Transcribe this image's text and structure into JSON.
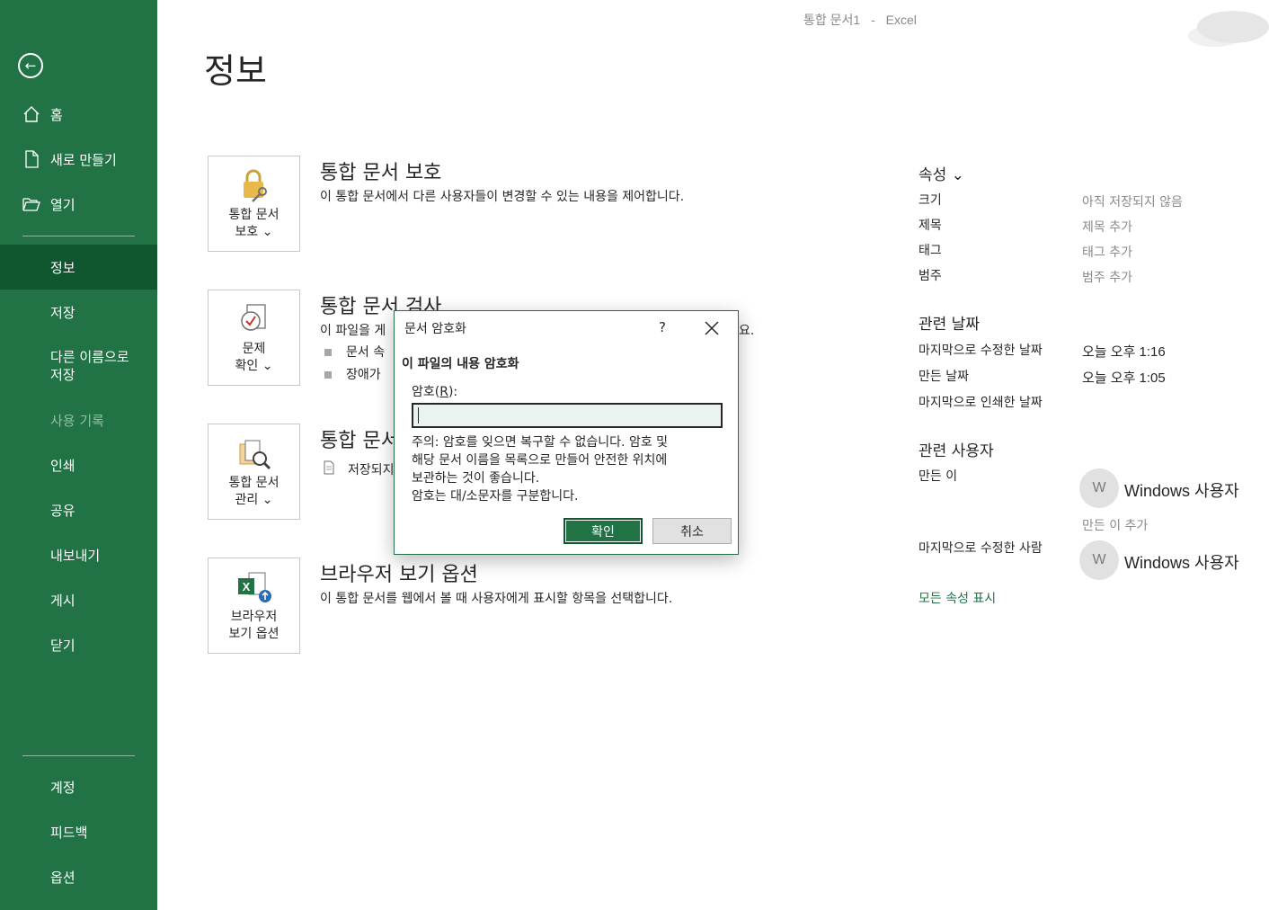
{
  "titlebar": {
    "doc": "통합 문서1",
    "sep": "-",
    "app": "Excel"
  },
  "sidebar": {
    "items": [
      {
        "label": "홈"
      },
      {
        "label": "새로 만들기"
      },
      {
        "label": "열기"
      },
      {
        "label": "정보"
      },
      {
        "label": "저장"
      },
      {
        "label": "다른 이름으로\n저장"
      },
      {
        "label": "사용 기록"
      },
      {
        "label": "인쇄"
      },
      {
        "label": "공유"
      },
      {
        "label": "내보내기"
      },
      {
        "label": "게시"
      },
      {
        "label": "닫기"
      },
      {
        "label": "계정"
      },
      {
        "label": "피드백"
      },
      {
        "label": "옵션"
      }
    ]
  },
  "main": {
    "title": "정보",
    "sections": [
      {
        "button": "통합 문서\n보호 ⌄",
        "title": "통합 문서 보호",
        "desc": "이 통합 문서에서 다른 사용자들이 변경할 수 있는 내용을 제어합니다."
      },
      {
        "button": "문제\n확인 ⌄",
        "title": "통합 문서 검사",
        "desc": "이 파일을 게",
        "desc_tail": "요.",
        "bullets": [
          "문서 속",
          "장애가"
        ]
      },
      {
        "button": "통합 문서\n관리 ⌄",
        "title": "통합 문서",
        "desc": "저장되지"
      },
      {
        "button": "브라우저\n보기 옵션",
        "title": "브라우저 보기 옵션",
        "desc": "이 통합 문서를 웹에서 볼 때 사용자에게 표시할 항목을 선택합니다."
      }
    ]
  },
  "properties": {
    "header": "속성 ⌄",
    "rows": [
      {
        "label": "크기",
        "value": "아직 저장되지 않음"
      },
      {
        "label": "제목",
        "value": "제목 추가"
      },
      {
        "label": "태그",
        "value": "태그 추가"
      },
      {
        "label": "범주",
        "value": "범주 추가"
      }
    ],
    "dates_header": "관련 날짜",
    "dates": [
      {
        "label": "마지막으로 수정한 날짜",
        "value": "오늘 오후 1:16"
      },
      {
        "label": "만든 날짜",
        "value": "오늘 오후 1:05"
      },
      {
        "label": "마지막으로 인쇄한 날짜",
        "value": ""
      }
    ],
    "people_header": "관련 사용자",
    "author_label": "만든 이",
    "author_avatar": "W",
    "author_name": "Windows 사용자",
    "add_author": "만든 이 추가",
    "modified_by_label": "마지막으로 수정한 사람",
    "modified_avatar": "W",
    "modified_by_name": "Windows 사용자",
    "show_all": "모든 속성 표시"
  },
  "dialog": {
    "title": "문서 암호화",
    "help": "?",
    "heading": "이 파일의 내용 암호화",
    "label_prefix": "암호(",
    "label_key": "R",
    "label_suffix": "):",
    "password_value": "",
    "note": "주의: 암호를 잊으면 복구할 수 없습니다. 암호 및\n해당 문서 이름을 목록으로 만들어 안전한 위치에\n보관하는 것이 좋습니다.\n암호는 대/소문자를 구분합니다.",
    "ok": "확인",
    "cancel": "취소"
  },
  "colors": {
    "brand": "#217346",
    "active": "#10572f"
  }
}
